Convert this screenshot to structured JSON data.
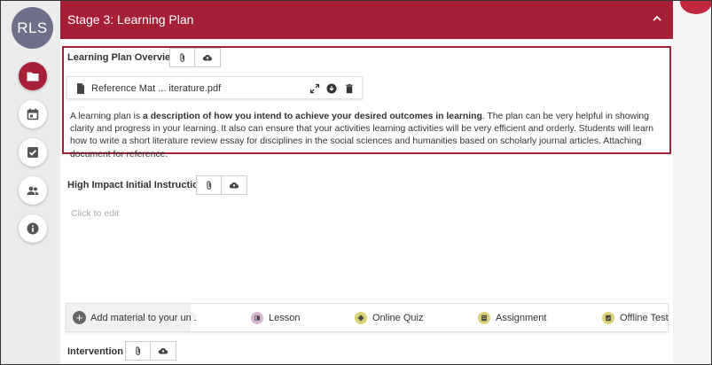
{
  "rail": {
    "avatar_initials": "RLS",
    "items": [
      {
        "icon": "folder-icon",
        "active": true
      },
      {
        "icon": "calendar-icon",
        "active": false
      },
      {
        "icon": "checkbox-icon",
        "active": false
      },
      {
        "icon": "people-icon",
        "active": false
      },
      {
        "icon": "info-icon",
        "active": false
      }
    ]
  },
  "stage": {
    "title": "Stage 3: Learning Plan",
    "collapse_icon": "chevron-up-icon"
  },
  "colors": {
    "accent": "#a52037",
    "avatar": "#6e7089",
    "lesson": "#d8b5cf",
    "quiz": "#d9d27a",
    "assignment": "#d9d27a",
    "offline": "#d9d27a"
  },
  "overview": {
    "label": "Learning Plan Overview",
    "tools": [
      "paperclip-icon",
      "cloud-upload-icon"
    ],
    "attachment": {
      "name": "Reference Mat ... iterature.pdf",
      "icon": "pdf-file-icon",
      "actions": [
        "expand-icon",
        "download-icon",
        "trash-icon"
      ]
    },
    "text_before": "A learning plan is ",
    "text_bold": "a description of how you intend to achieve your desired outcomes in learning",
    "text_after": ". The plan can be very helpful in showing clarity and progress in your learning. It also can ensure that your activities learning activities will be very efficient and orderly. Students will learn how to write a short literature review essay for disciplines in the social sciences and humanities based on scholarly journal articles. Attaching document for reference."
  },
  "instruction": {
    "label": "High Impact Initial Instruction",
    "placeholder": "Click to edit"
  },
  "materials": {
    "add_label": "Add material to your unit",
    "items": [
      {
        "label": "Lesson",
        "icon": "lesson-icon"
      },
      {
        "label": "Online Quiz",
        "icon": "quiz-icon"
      },
      {
        "label": "Assignment",
        "icon": "assignment-icon"
      },
      {
        "label": "Offline Test",
        "icon": "offline-test-icon"
      }
    ]
  },
  "intervention": {
    "label": "Intervention"
  }
}
